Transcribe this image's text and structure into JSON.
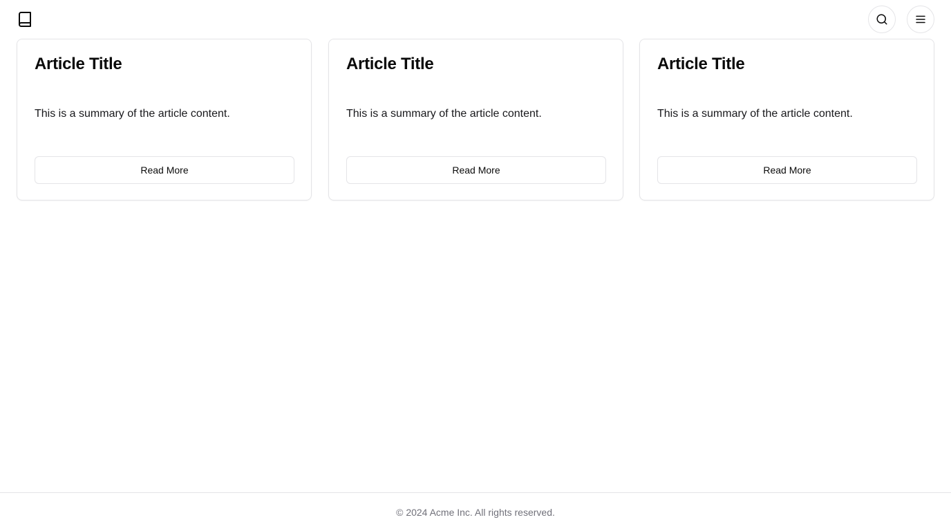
{
  "header": {
    "logo_icon": "book-icon",
    "search_icon": "search-icon",
    "menu_icon": "hamburger-menu-icon"
  },
  "articles": [
    {
      "title": "Article Title",
      "summary": "This is a summary of the article content.",
      "button_label": "Read More"
    },
    {
      "title": "Article Title",
      "summary": "This is a summary of the article content.",
      "button_label": "Read More"
    },
    {
      "title": "Article Title",
      "summary": "This is a summary of the article content.",
      "button_label": "Read More"
    }
  ],
  "footer": {
    "copyright": "© 2024 Acme Inc. All rights reserved."
  },
  "colors": {
    "border": "#e4e4e7",
    "text": "#0a0a0a",
    "muted_text": "#71717a",
    "background": "#ffffff"
  }
}
